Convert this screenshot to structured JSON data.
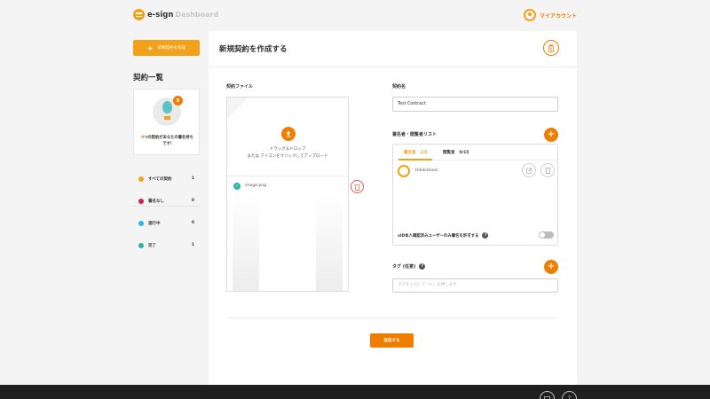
{
  "header": {
    "logo_text": "e-sign",
    "logo_sub": "Dashboard",
    "account_label": "マイアカウント"
  },
  "sidebar": {
    "create_button": "新規契約を作成",
    "list_title": "契約一覧",
    "pending": {
      "badge": "8",
      "count": "9",
      "text": "つの契約があなたの署名待ちです!"
    },
    "filters": [
      {
        "label": "すべての契約",
        "count": "1",
        "color": "#f2a21a"
      },
      {
        "label": "署名なし",
        "count": "0",
        "color": "#d81b60"
      },
      {
        "label": "進行中",
        "count": "0",
        "color": "#29b6e8"
      },
      {
        "label": "完了",
        "count": "1",
        "color": "#26b5a2"
      }
    ]
  },
  "main": {
    "title": "新規契約を作成する",
    "file_section": {
      "label": "契約ファイル",
      "drop_line1": "ドラッグ＆ドロップ",
      "drop_line2": "または アイコンをクリックしてアップロード",
      "file_name": "image.png"
    },
    "contract_name": {
      "label": "契約名",
      "value": "Test Contract"
    },
    "signers": {
      "label": "署名者・閲覧者リスト",
      "tab_signers": "署名者",
      "tab_signers_count": "1/5",
      "tab_viewers": "閲覧者",
      "tab_viewers_count": "0/15",
      "signer_name": "HibikiHosoi",
      "xid_text": "xID本人確認済みユーザーのみ署名を許可する",
      "help": "?"
    },
    "tags": {
      "label": "タグ (任意)",
      "help": "?",
      "placeholder": "タグを入力して「↵」を押します"
    },
    "submit": "送信する"
  },
  "colors": {
    "accent": "#ef7d00",
    "logo": "#f2a21a"
  }
}
